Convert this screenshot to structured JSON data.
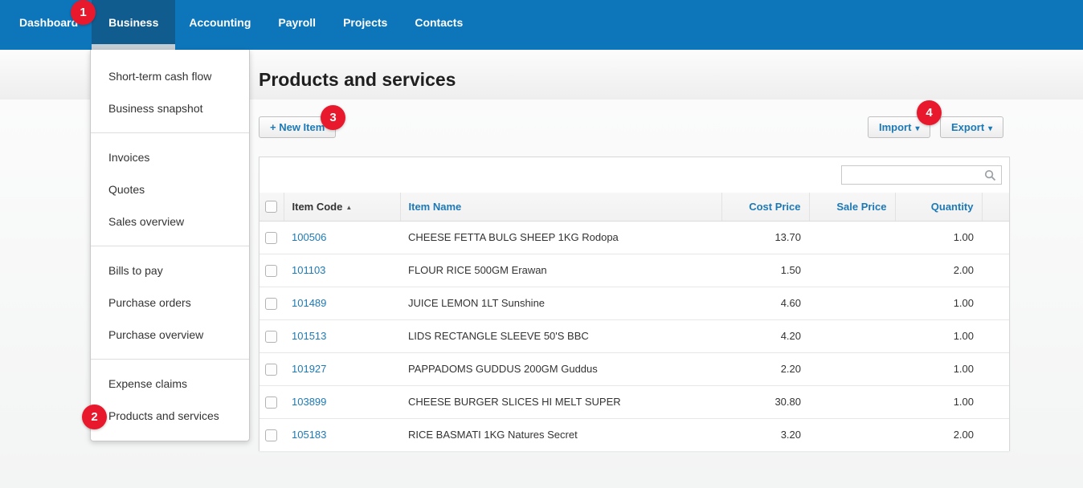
{
  "colors": {
    "nav": "#0d76bb",
    "nav_active": "#115c8f",
    "badge": "#e8192c",
    "link": "#1d79b5"
  },
  "nav": {
    "items": [
      {
        "label": "Dashboard",
        "active": false
      },
      {
        "label": "Business",
        "active": true
      },
      {
        "label": "Accounting",
        "active": false
      },
      {
        "label": "Payroll",
        "active": false
      },
      {
        "label": "Projects",
        "active": false
      },
      {
        "label": "Contacts",
        "active": false
      }
    ]
  },
  "dropdown": {
    "groups": [
      [
        "Short-term cash flow",
        "Business snapshot"
      ],
      [
        "Invoices",
        "Quotes",
        "Sales overview"
      ],
      [
        "Bills to pay",
        "Purchase orders",
        "Purchase overview"
      ],
      [
        "Expense claims",
        "Products and services"
      ]
    ]
  },
  "page": {
    "title": "Products and services"
  },
  "toolbar": {
    "new_item_label": "+ New Item",
    "import_label": "Import",
    "export_label": "Export",
    "caret": "▾"
  },
  "search": {
    "value": "",
    "placeholder": ""
  },
  "table": {
    "columns": [
      {
        "label": "Item Code",
        "sorted": "asc"
      },
      {
        "label": "Item Name"
      },
      {
        "label": "Cost Price",
        "align": "right"
      },
      {
        "label": "Sale Price",
        "align": "right"
      },
      {
        "label": "Quantity",
        "align": "right"
      }
    ],
    "rows": [
      {
        "code": "100506",
        "name": "CHEESE FETTA BULG SHEEP 1KG Rodopa",
        "cost": "13.70",
        "sale": "",
        "qty": "1.00"
      },
      {
        "code": "101103",
        "name": "FLOUR RICE 500GM Erawan",
        "cost": "1.50",
        "sale": "",
        "qty": "2.00"
      },
      {
        "code": "101489",
        "name": "JUICE LEMON 1LT Sunshine",
        "cost": "4.60",
        "sale": "",
        "qty": "1.00"
      },
      {
        "code": "101513",
        "name": "LIDS RECTANGLE SLEEVE 50'S BBC",
        "cost": "4.20",
        "sale": "",
        "qty": "1.00"
      },
      {
        "code": "101927",
        "name": "PAPPADOMS GUDDUS 200GM Guddus",
        "cost": "2.20",
        "sale": "",
        "qty": "1.00"
      },
      {
        "code": "103899",
        "name": "CHEESE BURGER SLICES HI MELT SUPER",
        "cost": "30.80",
        "sale": "",
        "qty": "1.00"
      },
      {
        "code": "105183",
        "name": "RICE BASMATI 1KG Natures Secret",
        "cost": "3.20",
        "sale": "",
        "qty": "2.00"
      }
    ]
  },
  "badges": [
    {
      "number": "1"
    },
    {
      "number": "2"
    },
    {
      "number": "3"
    },
    {
      "number": "4"
    }
  ],
  "sort_arrow": "▲"
}
